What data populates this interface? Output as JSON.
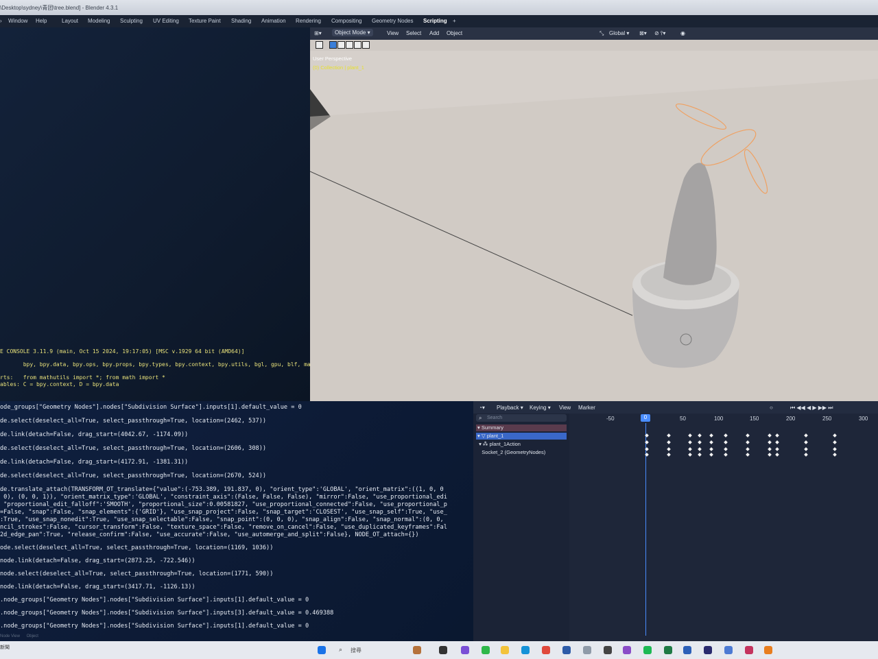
{
  "title_bar": {
    "text": "\\Desktop\\sydney\\青团\\tree.blend] - Blender 4.3.1"
  },
  "menu": {
    "items": [
      "Window",
      "Help"
    ],
    "workspaces": [
      "Layout",
      "Modeling",
      "Sculpting",
      "UV Editing",
      "Texture Paint",
      "Shading",
      "Animation",
      "Rendering",
      "Compositing",
      "Geometry Nodes",
      "Scripting"
    ],
    "active_workspace": "Scripting",
    "add_tab": "+"
  },
  "viewport": {
    "mode": "Object Mode",
    "menus": [
      "View",
      "Select",
      "Add",
      "Object"
    ],
    "orientation": "Global",
    "perspective": "User Perspective",
    "collection": "(0) Collection | plant_1"
  },
  "python_console": {
    "banner": [
      "E CONSOLE 3.11.9 (main, Oct 15 2024, 19:17:05) [MSC v.1929 64 bit (AMD64)]",
      "       bpy, bpy.data, bpy.ops, bpy.props, bpy.types, bpy.context, bpy.utils, bgl, gpu, blf, mathut",
      "rts:   from mathutils import *; from math import *",
      "ables: C = bpy.context, D = bpy.data"
    ]
  },
  "info_log": {
    "lines": [
      "ode_groups[\"Geometry Nodes\"].nodes[\"Subdivision Surface\"].inputs[1].default_value = 0",
      "de.select(deselect_all=True, select_passthrough=True, location=(2462, 537))",
      "de.link(detach=False, drag_start=(4042.67, -1174.09))",
      "de.select(deselect_all=True, select_passthrough=True, location=(2606, 308))",
      "de.link(detach=False, drag_start=(4172.91, -1381.31))",
      "de.select(deselect_all=True, select_passthrough=True, location=(2670, 524))",
      "de.translate_attach(TRANSFORM_OT_translate={\"value\":(-753.389, 191.837, 0), \"orient_type\":'GLOBAL', \"orient_matrix\":((1, 0, 0",
      " 0), (0, 0, 1)), \"orient_matrix_type\":'GLOBAL', \"constraint_axis\":(False, False, False), \"mirror\":False, \"use_proportional_edi",
      " \"proportional_edit_falloff\":'SMOOTH', \"proportional_size\":0.00581827, \"use_proportional_connected\":False, \"use_proportional_p",
      "=False, \"snap\":False, \"snap_elements\":{'GRID'}, \"use_snap_project\":False, \"snap_target\":'CLOSEST', \"use_snap_self\":True, \"use_",
      ":True, \"use_snap_nonedit\":True, \"use_snap_selectable\":False, \"snap_point\":(0, 0, 0), \"snap_align\":False, \"snap_normal\":(0, 0,",
      "ncil_strokes\":False, \"cursor_transform\":False, \"texture_space\":False, \"remove_on_cancel\":False, \"use_duplicated_keyframes\":Fal",
      "2d_edge_pan\":True, \"release_confirm\":False, \"use_accurate\":False, \"use_automerge_and_split\":False}, NODE_OT_attach={})",
      "ode.select(deselect_all=True, select_passthrough=True, location=(1169, 1036))",
      "node.link(detach=False, drag_start=(2873.25, -722.546))",
      "node.select(deselect_all=True, select_passthrough=True, location=(1771, 590))",
      "node.link(detach=False, drag_start=(3417.71, -1126.13))",
      ".node_groups[\"Geometry Nodes\"].nodes[\"Subdivision Surface\"].inputs[1].default_value = 0",
      ".node_groups[\"Geometry Nodes\"].nodes[\"Subdivision Surface\"].inputs[3].default_value = 0.469388",
      ".node_groups[\"Geometry Nodes\"].nodes[\"Subdivision Surface\"].inputs[1].default_value = 0"
    ]
  },
  "timeline": {
    "menus": [
      "Playback",
      "Keying",
      "View",
      "Marker"
    ],
    "search_placeholder": "Search",
    "channels": [
      "Summary",
      "plant_1",
      "plant_1Action",
      "Socket_2 (GeometryNodes)"
    ],
    "ticks": [
      "-50",
      "0",
      "50",
      "100",
      "150",
      "200",
      "250",
      "300"
    ],
    "current_frame": "0"
  },
  "status_bar": {
    "left": "Node View",
    "mid": "Object"
  },
  "taskbar": {
    "search": "搜尋",
    "corner": "新聞"
  }
}
